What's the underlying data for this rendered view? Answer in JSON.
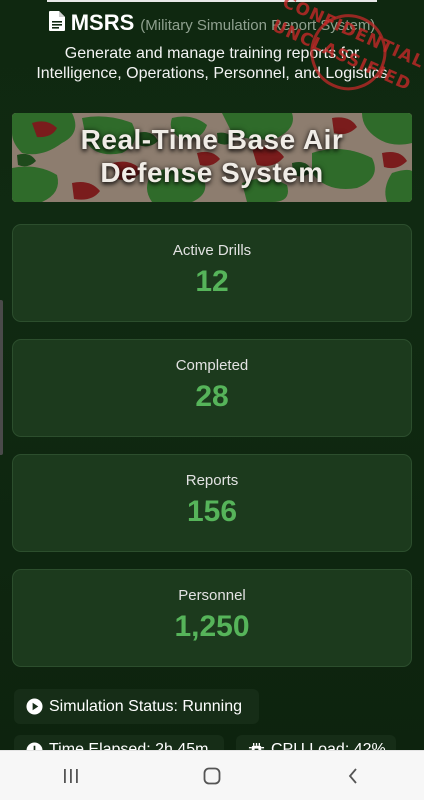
{
  "header": {
    "brand": "MSRS",
    "brand_subtitle": "(Military Simulation Report System)",
    "tagline_line1": "Generate and manage training reports for",
    "tagline_line2": "Intelligence, Operations, Personnel, and Logistics",
    "icon": "document-icon"
  },
  "stamp": {
    "line1": "CONFIDENTIAL",
    "line2": "UNCLASSIFIED",
    "color": "#c42828"
  },
  "banner": {
    "title_line1": "Real-Time Base Air",
    "title_line2": "Defense System"
  },
  "stats": [
    {
      "label": "Active Drills",
      "value": "12"
    },
    {
      "label": "Completed",
      "value": "28"
    },
    {
      "label": "Reports",
      "value": "156"
    },
    {
      "label": "Personnel",
      "value": "1,250"
    }
  ],
  "status": {
    "simulation": "Simulation Status: Running",
    "time_elapsed": "Time Elapsed: 2h 45m",
    "cpu_load": "CPU Load: 42%"
  },
  "colors": {
    "accent_green": "#56b45a",
    "background": "#0f2810",
    "card": "#1c3a1d"
  },
  "navbar": {
    "recent_icon": "recent-apps-icon",
    "home_icon": "home-icon",
    "back_icon": "back-icon"
  }
}
